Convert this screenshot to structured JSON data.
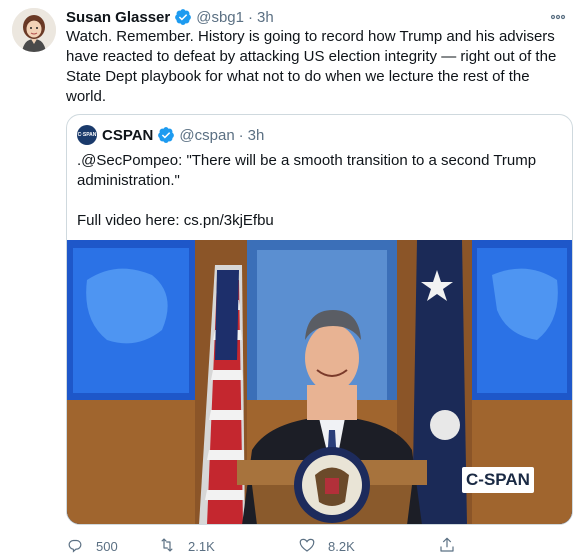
{
  "author": {
    "name": "Susan Glasser",
    "handle": "@sbg1",
    "separator": "·",
    "time": "3h"
  },
  "tweet_text": "Watch. Remember. History is going to record how Trump and his advisers have reacted to defeat by attacking US election integrity — right out of the State Dept playbook for what not to do when we lecture the rest of the world.",
  "quoted": {
    "name": "CSPAN",
    "handle": "@cspan",
    "separator": "·",
    "time": "3h",
    "text_line1": ".@SecPompeo: \"There will be a smooth transition to a second Trump administration.\"",
    "text_line2": "Full video here: cs.pn/3kjEfbu",
    "video_logo": "C-SPAN"
  },
  "actions": {
    "replies": "500",
    "retweets": "2.1K",
    "likes": "8.2K"
  },
  "colors": {
    "verified": "#1d9bf0",
    "secondary_text": "#5b7083",
    "border": "#cfd9de"
  },
  "icons": {
    "more": "more-icon",
    "reply": "reply-icon",
    "retweet": "retweet-icon",
    "like": "heart-icon",
    "share": "share-icon",
    "verified": "verified-badge-icon"
  }
}
